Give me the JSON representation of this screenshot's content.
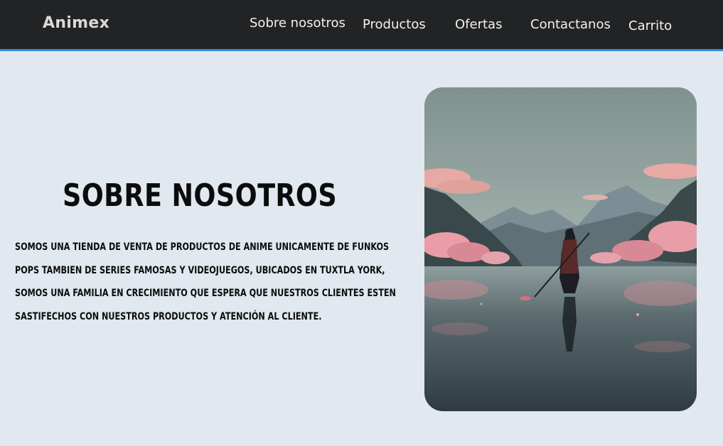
{
  "header": {
    "logo": "Animex",
    "nav": [
      {
        "label": "Sobre nosotros"
      },
      {
        "label": "Productos"
      },
      {
        "label": "Ofertas"
      },
      {
        "label": "Contactanos"
      },
      {
        "label": "Carrito"
      }
    ]
  },
  "hero": {
    "title": "SOBRE NOSOTROS",
    "description": "SOMOS UNA TIENDA DE VENTA DE PRODUCTOS DE ANIME  UNICAMENTE DE FUNKOS POPS TAMBIEN DE SERIES FAMOSAS Y VIDEOJUEGOS, UBICADOS EN TUXTLA YORK, SOMOS UNA FAMILIA EN CRECIMIENTO QUE ESPERA QUE NUESTROS CLIENTES ESTEN SASTIFECHOS CON NUESTROS PRODUCTOS Y ATENCIÓN AL CLIENTE."
  },
  "colors": {
    "navbar_bg": "#222324",
    "navbar_border": "#2e8be0",
    "page_bg": "#e1e8ef",
    "text": "#0c0c0c"
  }
}
